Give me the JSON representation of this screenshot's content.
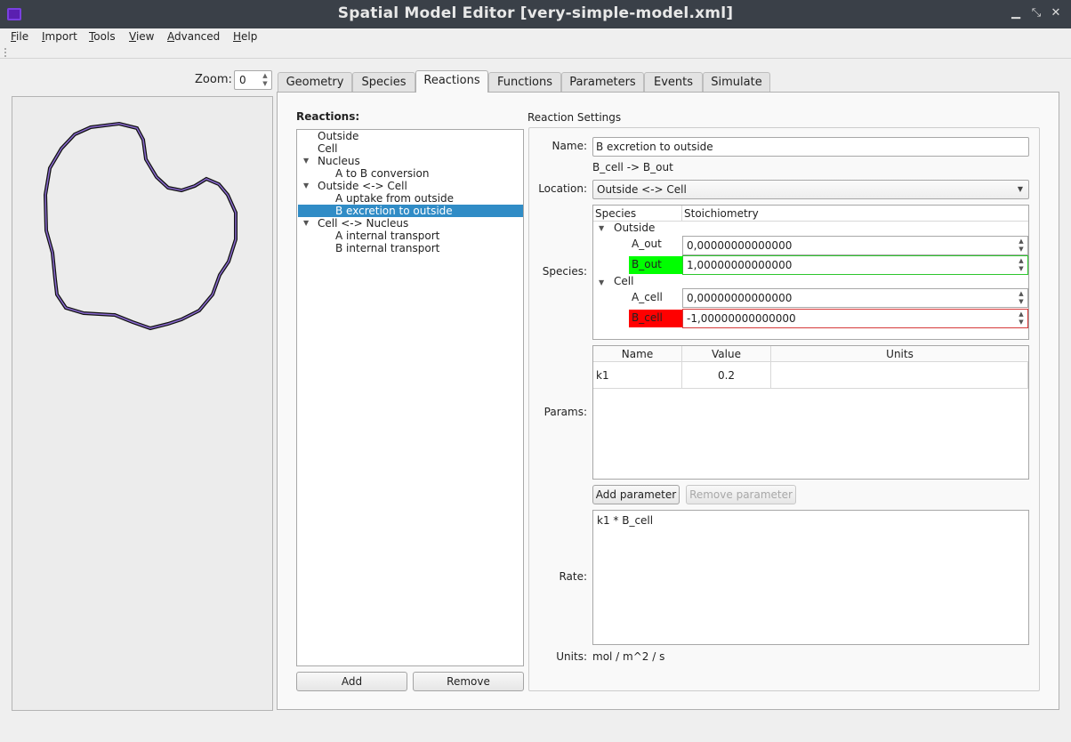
{
  "window": {
    "title": "Spatial Model Editor [very-simple-model.xml]"
  },
  "menu": [
    "File",
    "Import",
    "Tools",
    "View",
    "Advanced",
    "Help"
  ],
  "zoom": {
    "label": "Zoom:",
    "value": "0"
  },
  "tabs": [
    "Geometry",
    "Species",
    "Reactions",
    "Functions",
    "Parameters",
    "Events",
    "Simulate"
  ],
  "active_tab": "Reactions",
  "reactions": {
    "label": "Reactions:",
    "tree": [
      {
        "text": "Outside",
        "level": 0,
        "expandable": false
      },
      {
        "text": "Cell",
        "level": 0,
        "expandable": false
      },
      {
        "text": "Nucleus",
        "level": 0,
        "expandable": true
      },
      {
        "text": "A to B conversion",
        "level": 1,
        "expandable": false
      },
      {
        "text": "Outside <-> Cell",
        "level": 0,
        "expandable": true
      },
      {
        "text": "A uptake from outside",
        "level": 1,
        "expandable": false
      },
      {
        "text": "B excretion to outside",
        "level": 1,
        "expandable": false,
        "selected": true
      },
      {
        "text": "Cell <-> Nucleus",
        "level": 0,
        "expandable": true
      },
      {
        "text": "A internal transport",
        "level": 1,
        "expandable": false
      },
      {
        "text": "B internal transport",
        "level": 1,
        "expandable": false
      }
    ],
    "add_button": "Add",
    "remove_button": "Remove"
  },
  "settings": {
    "group_title": "Reaction Settings",
    "name_label": "Name:",
    "name_value": "B excretion to outside",
    "equation": "B_cell -> B_out",
    "location_label": "Location:",
    "location_value": "Outside <-> Cell",
    "species_label": "Species:",
    "species_headers": {
      "species": "Species",
      "stoichiometry": "Stoichiometry"
    },
    "species_groups": [
      {
        "compartment": "Outside",
        "rows": [
          {
            "name": "A_out",
            "value": "0,00000000000000",
            "highlight": "none"
          },
          {
            "name": "B_out",
            "value": "1,00000000000000",
            "highlight": "green"
          }
        ]
      },
      {
        "compartment": "Cell",
        "rows": [
          {
            "name": "A_cell",
            "value": "0,00000000000000",
            "highlight": "none"
          },
          {
            "name": "B_cell",
            "value": "-1,00000000000000",
            "highlight": "red"
          }
        ]
      }
    ],
    "params_label": "Params:",
    "params_headers": {
      "name": "Name",
      "value": "Value",
      "units": "Units"
    },
    "params_rows": [
      {
        "name": "k1",
        "value": "0.2",
        "units": ""
      }
    ],
    "add_parameter": "Add parameter",
    "remove_parameter": "Remove parameter",
    "rate_label": "Rate:",
    "rate_expression": "k1 * B_cell",
    "units_label": "Units:",
    "units_value": "mol / m^2 / s"
  },
  "colors": {
    "selection": "#308cc6",
    "positive": "#00ff00",
    "negative": "#ff0000",
    "titlebar": "#3a4048",
    "outline": "#8060c8"
  }
}
